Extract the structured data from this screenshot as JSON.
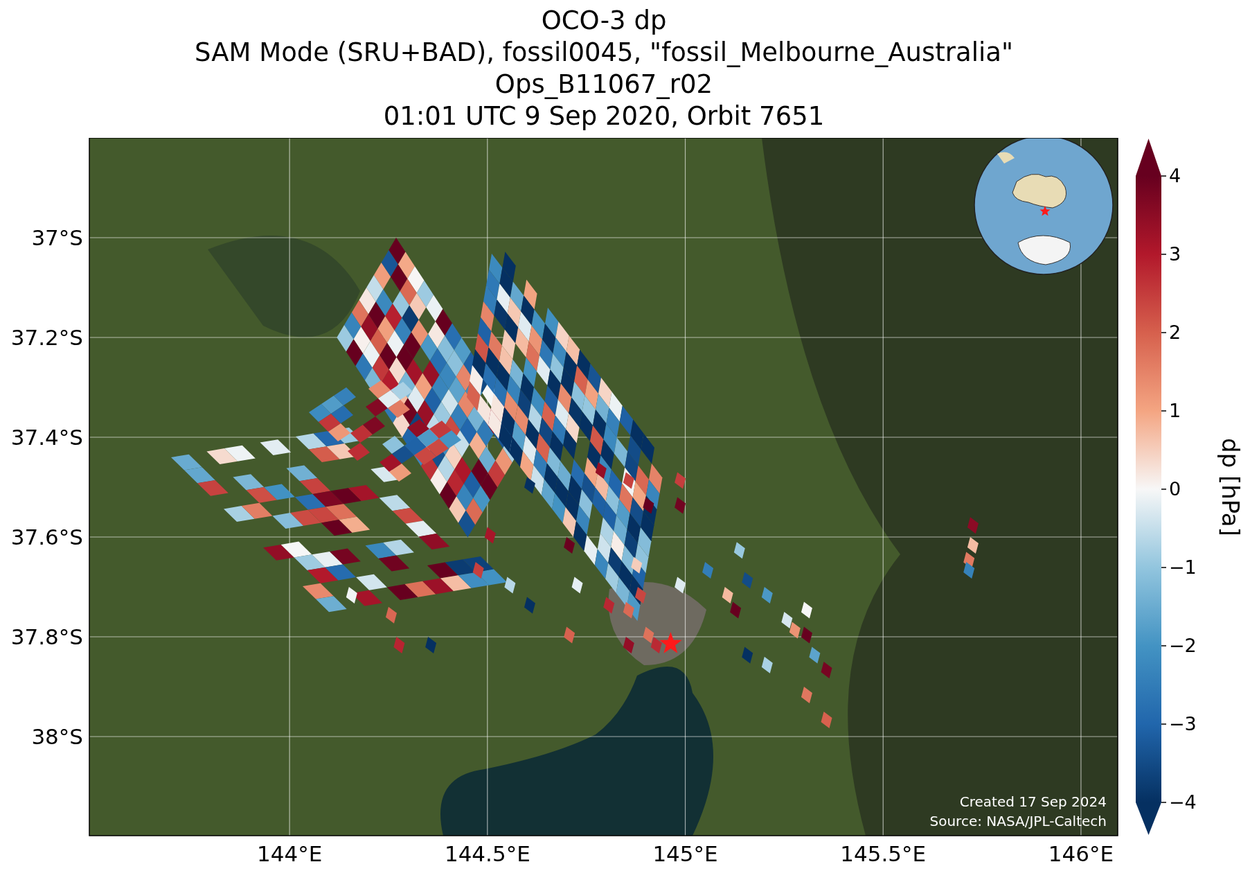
{
  "title": {
    "lines": [
      "OCO-3 dp",
      "SAM Mode (SRU+BAD), fossil0045, \"fossil_Melbourne_Australia\"",
      "Ops_B11067_r02",
      "01:01 UTC 9 Sep 2020, Orbit 7651"
    ]
  },
  "x_ticks": [
    "144°E",
    "144.5°E",
    "145°E",
    "145.5°E",
    "146°E"
  ],
  "y_ticks": [
    "37°S",
    "37.2°S",
    "37.4°S",
    "37.6°S",
    "37.8°S",
    "38°S"
  ],
  "colorbar": {
    "label": "dp [hPa]",
    "ticks": [
      "4",
      "3",
      "2",
      "1",
      "0",
      "−1",
      "−2",
      "−3",
      "−4"
    ]
  },
  "credits": [
    "Created 17 Sep 2024",
    "Source: NASA/JPL-Caltech"
  ]
}
